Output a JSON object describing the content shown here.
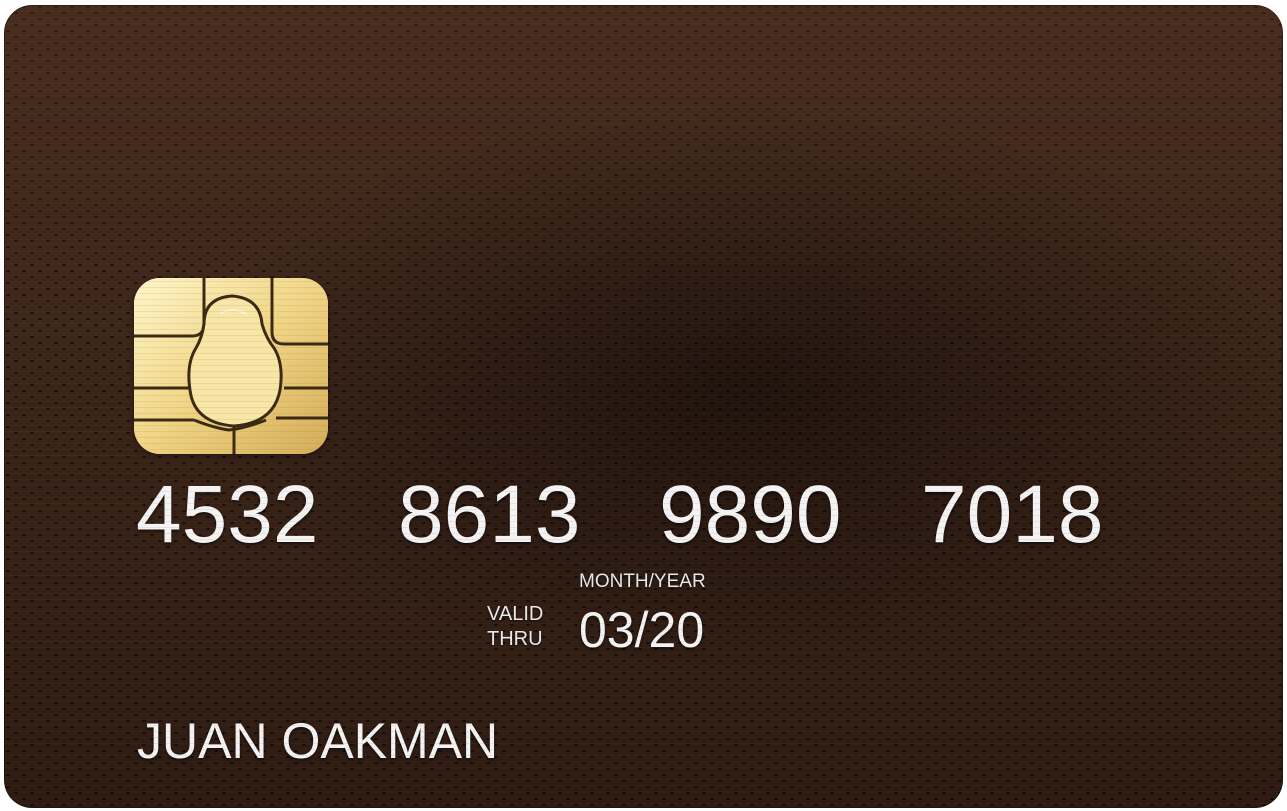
{
  "card": {
    "number_groups": [
      "4532",
      "8613",
      "9890",
      "7018"
    ],
    "valid_thru_label_line1": "VALID",
    "valid_thru_label_line2": "THRU",
    "expiry_caption": "MONTH/YEAR",
    "expiry": "03/20",
    "holder_name": "JUAN OAKMAN"
  },
  "colors": {
    "card_background": "#3b2418",
    "text": "#f3f3f3",
    "chip_gold": "#e7c66f"
  },
  "icons": {
    "chip": "emv-chip-icon"
  }
}
